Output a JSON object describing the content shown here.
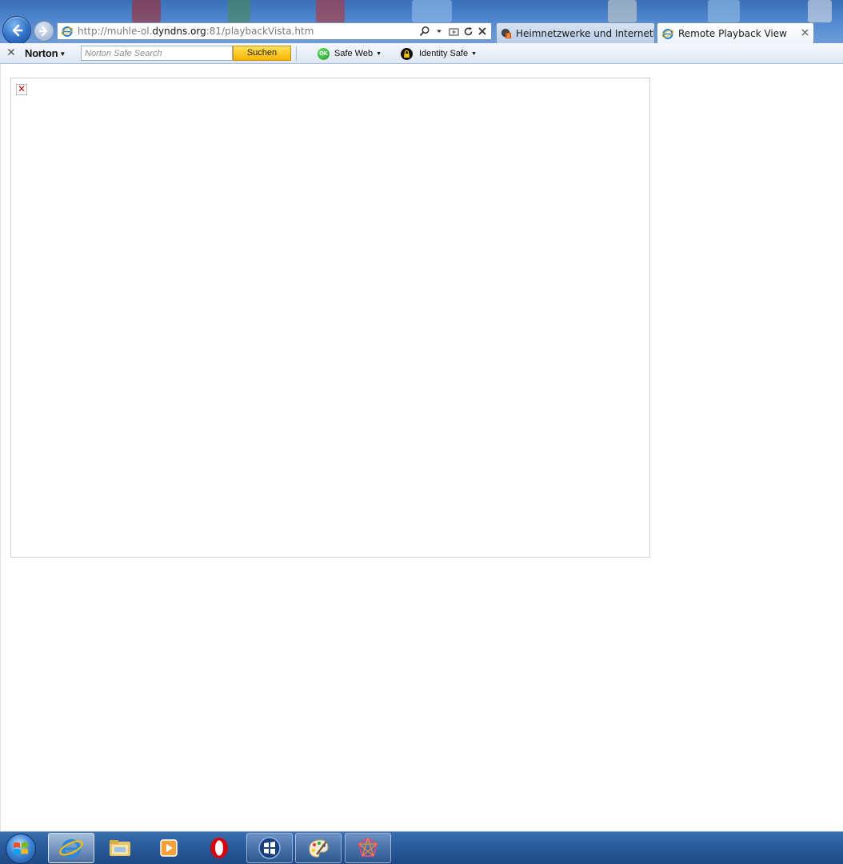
{
  "browser": {
    "address_bar": {
      "url_prefix": "http://muhle-ol.",
      "url_domain": "dyndns.org",
      "url_suffix": ":81/playbackVista.htm"
    },
    "tabs": [
      {
        "label": "Heimnetzwerke und Internetha...",
        "active": false,
        "icon": "site-favicon-icon"
      },
      {
        "label": "Remote Playback View",
        "active": true,
        "icon": "ie-favicon-icon"
      }
    ]
  },
  "norton_toolbar": {
    "logo": "Norton",
    "search_placeholder": "Norton Safe Search",
    "search_button": "Suchen",
    "safe_web_label": "Safe Web",
    "safe_web_badge": "OK",
    "identity_safe_label": "Identity Safe"
  },
  "colors": {
    "chrome_blue": "#4f86cd",
    "search_button": "#f7b500",
    "safe_web_ok": "#1e9b1e",
    "taskbar": "#2a5b9c"
  },
  "taskbar": {
    "items": [
      {
        "name": "start-orb-icon"
      },
      {
        "name": "internet-explorer-icon",
        "active": true
      },
      {
        "name": "file-explorer-icon"
      },
      {
        "name": "media-player-icon"
      },
      {
        "name": "opera-icon"
      },
      {
        "name": "windows-logo-icon"
      },
      {
        "name": "paint-icon"
      },
      {
        "name": "zune-icon"
      }
    ]
  }
}
